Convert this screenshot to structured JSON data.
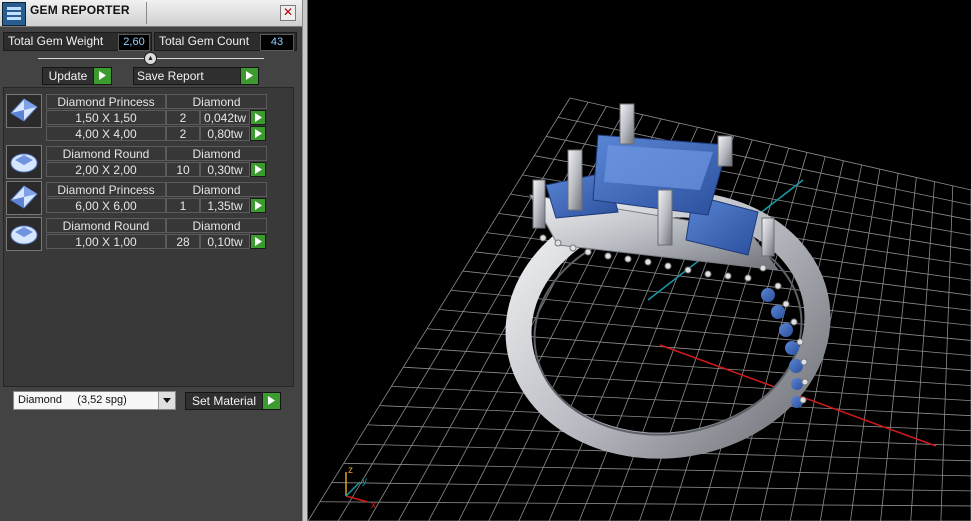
{
  "window": {
    "title": "GEM REPORTER",
    "close_symbol": "✕"
  },
  "stats": {
    "total_weight_label": "Total Gem Weight",
    "total_weight_value": "2,60",
    "total_count_label": "Total Gem Count",
    "total_count_value": "43"
  },
  "toolbar": {
    "update_label": "Update",
    "save_label": "Save Report"
  },
  "gems": [
    {
      "name": "Diamond Princess",
      "material": "Diamond",
      "shape": "princess",
      "rows": [
        {
          "size": "1,50 X 1,50",
          "count": "2",
          "weight": "0,042tw"
        },
        {
          "size": "4,00 X 4,00",
          "count": "2",
          "weight": "0,80tw"
        }
      ]
    },
    {
      "name": "Diamond Round",
      "material": "Diamond",
      "shape": "round",
      "rows": [
        {
          "size": "2,00 X 2,00",
          "count": "10",
          "weight": "0,30tw"
        }
      ]
    },
    {
      "name": "Diamond Princess",
      "material": "Diamond",
      "shape": "princess",
      "rows": [
        {
          "size": "6,00 X 6,00",
          "count": "1",
          "weight": "1,35tw"
        }
      ]
    },
    {
      "name": "Diamond Round",
      "material": "Diamond",
      "shape": "round",
      "rows": [
        {
          "size": "1,00 X 1,00",
          "count": "28",
          "weight": "0,10tw"
        }
      ]
    }
  ],
  "material": {
    "selected": "Diamond     (3,52 spg)",
    "set_label": "Set Material"
  },
  "viewport": {
    "axis_labels": {
      "x": "x",
      "y": "y",
      "z": "z"
    },
    "colors": {
      "background": "#000000",
      "grid": "#8c8c8c",
      "x_axis": "#d01a1a",
      "y_axis": "#1a9aa8",
      "metal": "#c9cbd0",
      "gem": "#3b67b8"
    }
  },
  "icons": {
    "app": "gem-reporter-app-icon",
    "update_go": "green-play-icon",
    "dropdown": "chevron-down-icon"
  }
}
